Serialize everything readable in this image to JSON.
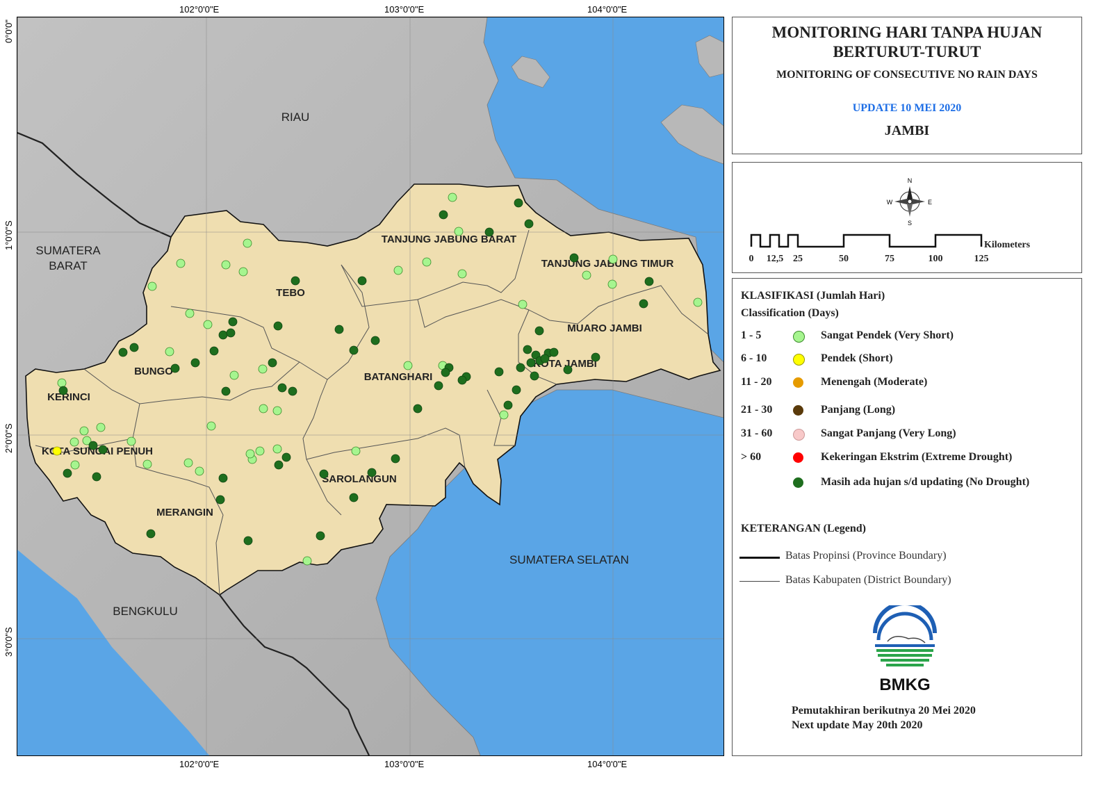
{
  "title": {
    "line1": "MONITORING HARI TANPA HUJAN",
    "line2": "BERTURUT-TURUT",
    "subtitle": "MONITORING OF CONSECUTIVE NO RAIN DAYS",
    "update": "UPDATE 10 MEI 2020",
    "region": "JAMBI"
  },
  "grid_labels": {
    "lon": [
      "102°0'0\"E",
      "103°0'0\"E",
      "104°0'0\"E"
    ],
    "lat": [
      "0°0'0\"",
      "1°0'0\"S",
      "2°0'0\"S",
      "3°0'0\"S"
    ]
  },
  "map_labels": {
    "riau": "RIAU",
    "sumatera_barat_1": "SUMATERA",
    "sumatera_barat_2": "BARAT",
    "bengkulu": "BENGKULU",
    "sumatera_selatan": "SUMATERA SELATAN",
    "tebo": "TEBO",
    "bungo": "BUNGO",
    "kerinci": "KERINCI",
    "kota_sungai_penuh": "KOTA SUNGAI PENUH",
    "merangin": "MERANGIN",
    "sarolangun": "SAROLANGUN",
    "batanghari": "BATANGHARI",
    "muaro_jambi": "MUARO JAMBI",
    "kota_jambi": "KOTA JAMBI",
    "tanjung_jabung_barat": "TANJUNG JABUNG BARAT",
    "tanjung_jabung_timur": "TANJUNG JABUNG TIMUR"
  },
  "compass": {
    "n": "N",
    "s": "S",
    "e": "E",
    "w": "W"
  },
  "scale_bar": {
    "unit": "Kilometers",
    "ticks": [
      "0",
      "12,5",
      "25",
      "50",
      "75",
      "100",
      "125"
    ]
  },
  "classification": {
    "heading1": "KLASIFIKASI (Jumlah Hari)",
    "heading2": "Classification (Days)",
    "classes": [
      {
        "range": "1 - 5",
        "label": "Sangat Pendek  (Very Short)",
        "color": "#a6f58f"
      },
      {
        "range": "6 - 10",
        "label": "Pendek  (Short)",
        "color": "#ffff00"
      },
      {
        "range": "11 - 20",
        "label": "Menengah  (Moderate)",
        "color": "#e69b00"
      },
      {
        "range": "21 - 30",
        "label": "Panjang  (Long)",
        "color": "#5a3a0a"
      },
      {
        "range": "31 - 60",
        "label": "Sangat Panjang  (Very Long)",
        "color": "#f8c9c9"
      },
      {
        "range": "> 60",
        "label": "Kekeringan Ekstrim  (Extreme Drought)",
        "color": "#ff0000"
      },
      {
        "range": "",
        "label": "Masih ada hujan s/d updating  (No Drought)",
        "color": "#1e6e1e"
      }
    ]
  },
  "legend": {
    "heading": "KETERANGAN  (Legend)",
    "province": "Batas Propinsi (Province Boundary)",
    "district": "Batas Kabupaten (District Boundary)"
  },
  "logo": {
    "text": "BMKG"
  },
  "next_update": {
    "id": "Pemutakhiran berikutnya 20 Mei 2020",
    "en": "Next update May 20th 2020"
  },
  "colors": {
    "sea": "#5aa5e6",
    "land_outside": "#b4b4b4",
    "jambi": "#efdeb0",
    "very_short": "#a6f58f",
    "short": "#ffff00",
    "no_drought": "#1e6e1e"
  },
  "stations": {
    "very_short": [
      [
        650,
        283
      ],
      [
        659,
        332
      ],
      [
        613,
        376
      ],
      [
        572,
        388
      ],
      [
        664,
        393
      ],
      [
        355,
        349
      ],
      [
        324,
        380
      ],
      [
        349,
        390
      ],
      [
        259,
        378
      ],
      [
        218,
        411
      ],
      [
        272,
        450
      ],
      [
        298,
        466
      ],
      [
        243,
        505
      ],
      [
        377,
        530
      ],
      [
        336,
        539
      ],
      [
        586,
        525
      ],
      [
        636,
        525
      ],
      [
        378,
        587
      ],
      [
        398,
        590
      ],
      [
        303,
        612
      ],
      [
        120,
        619
      ],
      [
        144,
        614
      ],
      [
        106,
        635
      ],
      [
        124,
        633
      ],
      [
        88,
        550
      ],
      [
        188,
        634
      ],
      [
        211,
        667
      ],
      [
        270,
        665
      ],
      [
        286,
        677
      ],
      [
        373,
        648
      ],
      [
        362,
        660
      ],
      [
        398,
        645
      ],
      [
        359,
        652
      ],
      [
        511,
        648
      ],
      [
        441,
        806
      ],
      [
        751,
        437
      ],
      [
        843,
        395
      ],
      [
        881,
        372
      ],
      [
        880,
        408
      ],
      [
        1003,
        434
      ],
      [
        724,
        596
      ],
      [
        107,
        668
      ]
    ],
    "short": [
      [
        81,
        648
      ]
    ],
    "no_drought": [
      [
        637,
        308
      ],
      [
        703,
        333
      ],
      [
        745,
        291
      ],
      [
        760,
        321
      ],
      [
        825,
        370
      ],
      [
        933,
        404
      ],
      [
        925,
        436
      ],
      [
        520,
        403
      ],
      [
        424,
        403
      ],
      [
        334,
        462
      ],
      [
        320,
        481
      ],
      [
        331,
        478
      ],
      [
        399,
        468
      ],
      [
        487,
        473
      ],
      [
        508,
        503
      ],
      [
        539,
        489
      ],
      [
        391,
        521
      ],
      [
        307,
        504
      ],
      [
        280,
        521
      ],
      [
        192,
        499
      ],
      [
        176,
        506
      ],
      [
        251,
        529
      ],
      [
        775,
        475
      ],
      [
        758,
        502
      ],
      [
        788,
        507
      ],
      [
        770,
        510
      ],
      [
        776,
        518
      ],
      [
        783,
        515
      ],
      [
        763,
        521
      ],
      [
        796,
        506
      ],
      [
        748,
        528
      ],
      [
        856,
        513
      ],
      [
        816,
        531
      ],
      [
        768,
        540
      ],
      [
        742,
        560
      ],
      [
        717,
        534
      ],
      [
        645,
        528
      ],
      [
        640,
        535
      ],
      [
        670,
        541
      ],
      [
        664,
        546
      ],
      [
        630,
        554
      ],
      [
        600,
        587
      ],
      [
        730,
        582
      ],
      [
        405,
        557
      ],
      [
        420,
        562
      ],
      [
        324,
        562
      ],
      [
        411,
        657
      ],
      [
        400,
        668
      ],
      [
        320,
        687
      ],
      [
        568,
        659
      ],
      [
        534,
        679
      ],
      [
        465,
        681
      ],
      [
        508,
        715
      ],
      [
        316,
        718
      ],
      [
        460,
        770
      ],
      [
        356,
        777
      ],
      [
        216,
        767
      ],
      [
        138,
        685
      ],
      [
        96,
        680
      ],
      [
        133,
        640
      ],
      [
        147,
        646
      ],
      [
        90,
        561
      ]
    ]
  }
}
